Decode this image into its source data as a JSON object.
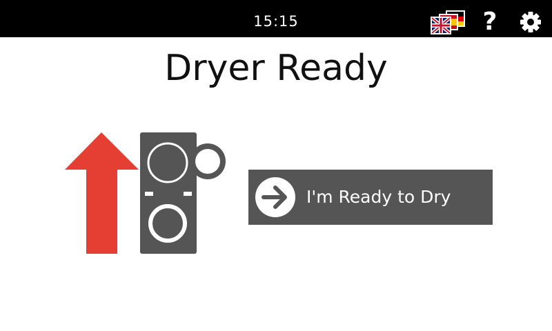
{
  "header": {
    "time": "15:15",
    "icons": [
      "language-flags-icon",
      "help-icon",
      "gear-icon"
    ]
  },
  "main": {
    "title": "Dryer Ready",
    "ready_button_label": "I'm Ready to Dry",
    "illustration": "arrow-up-stacked-washer-dryer-icon"
  },
  "colors": {
    "topbar": "#000000",
    "arrow": "#e53e32",
    "machine": "#555555",
    "button": "#555555",
    "text": "#111111"
  }
}
